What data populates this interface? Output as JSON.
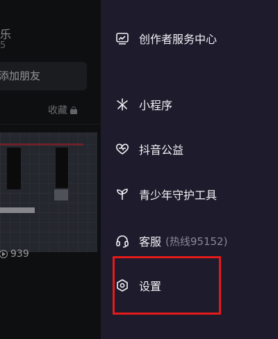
{
  "profile": {
    "name_fragment": "乐",
    "sub_fragment": "5",
    "add_friend_label": "添加朋友"
  },
  "tabs": {
    "left_fragment": "",
    "favorites_label": "收藏"
  },
  "video": {
    "play_count": "939"
  },
  "menu": {
    "items": [
      {
        "label": "创作者服务中心",
        "sub": "",
        "icon": "creator-service-icon"
      },
      {
        "label": "小程序",
        "sub": "",
        "icon": "mini-program-icon"
      },
      {
        "label": "抖音公益",
        "sub": "",
        "icon": "charity-heart-icon"
      },
      {
        "label": "青少年守护工具",
        "sub": "",
        "icon": "sprout-icon"
      },
      {
        "label": "客服",
        "sub": "(热线95152)",
        "icon": "headset-icon"
      },
      {
        "label": "设置",
        "sub": "",
        "icon": "settings-hexagon-icon"
      }
    ]
  },
  "colors": {
    "drawer_bg": "#1e1c2c",
    "highlight": "#e51a1a"
  }
}
